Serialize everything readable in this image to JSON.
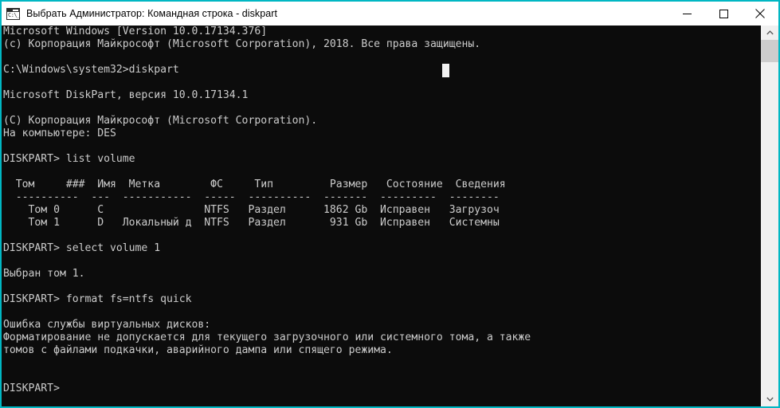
{
  "window": {
    "title": "Выбрать Администратор: Командная строка - diskpart",
    "icon": "console-icon",
    "icon_glyph": "C:\\_",
    "accent_color": "#00b7c3",
    "titlebar_bg": "#ffffff",
    "console_bg": "#0c0c0c",
    "console_fg": "#cccccc",
    "controls": {
      "minimize_label": "Свернуть",
      "maximize_label": "Развернуть",
      "close_label": "Закрыть"
    }
  },
  "scrollbar": {
    "up_arrow": "▲",
    "down_arrow": "▼",
    "thumb_position_percent": 0,
    "track_color": "#f0f0f0",
    "thumb_color": "#cdcdcd"
  },
  "console": {
    "cursor_visible": true,
    "lines": [
      "Microsoft Windows [Version 10.0.17134.376]",
      "(c) Корпорация Майкрософт (Microsoft Corporation), 2018. Все права защищены.",
      "",
      "C:\\Windows\\system32>diskpart",
      "",
      "Microsoft DiskPart, версия 10.0.17134.1",
      "",
      "(C) Корпорация Майкрософт (Microsoft Corporation).",
      "На компьютере: DES",
      "",
      "DISKPART> list volume",
      "",
      "  Том     ###  Имя  Метка        ФС     Тип         Размер   Состояние  Сведения",
      "  ----------  ---  ---  -----------  -----  ----------  -------  ---------  --------",
      "    Том 0     C                     NTFS   Раздел      1862 Gb  Исправен   Загрузоч",
      "    Том 1     D    Локальный д  NTFS   Раздел       931 Gb  Исправен   Системны",
      "",
      "DISKPART> select volume 1",
      "",
      "Выбран том 1.",
      "",
      "DISKPART> format fs=ntfs quick",
      "",
      "Ошибка службы виртуальных дисков:",
      "Форматирование не допускается для текущего загрузочного или системного тома, а также",
      "томов с файлами подкачки, аварийного дампа или спящего режима.",
      "",
      "",
      "DISKPART>"
    ],
    "rendered_text": "Microsoft Windows [Version 10.0.17134.376]\n(c) Корпорация Майкрософт (Microsoft Corporation), 2018. Все права защищены.\n\nC:\\Windows\\system32>diskpart\n\nMicrosoft DiskPart, версия 10.0.17134.1\n\n(C) Корпорация Майкрософт (Microsoft Corporation).\nНа компьютере: DES\n\nDISKPART> list volume\n\n  Том     ###  Имя  Метка        ФС     Тип         Размер   Состояние  Сведения\n  ----------  ---  -----------  -----  ----------  -------  ---------  --------\n    Том 0      C                NTFS   Раздел      1862 Gb  Исправен   Загрузоч\n    Том 1      D   Локальный д  NTFS   Раздел       931 Gb  Исправен   Системны\n\nDISKPART> select volume 1\n\nВыбран том 1.\n\nDISKPART> format fs=ntfs quick\n\nОшибка службы виртуальных дисков:\nФорматирование не допускается для текущего загрузочного или системного тома, а также\nтомов с файлами подкачки, аварийного дампа или спящего режима.\n\n\nDISKPART>",
    "volume_table": {
      "headers": [
        "Том",
        "###",
        "Имя",
        "Метка",
        "ФС",
        "Тип",
        "Размер",
        "Состояние",
        "Сведения"
      ],
      "rows": [
        [
          "Том 0",
          "",
          "C",
          "",
          "NTFS",
          "Раздел",
          "1862 Gb",
          "Исправен",
          "Загрузоч"
        ],
        [
          "Том 1",
          "",
          "D",
          "Локальный д",
          "NTFS",
          "Раздел",
          "931 Gb",
          "Исправен",
          "Системны"
        ]
      ]
    },
    "commands": [
      "diskpart",
      "list volume",
      "select volume 1",
      "format fs=ntfs quick"
    ],
    "messages": [
      "Выбран том 1.",
      "Ошибка службы виртуальных дисков:",
      "Форматирование не допускается для текущего загрузочного или системного тома, а также томов с файлами подкачки, аварийного дампа или спящего режима."
    ],
    "prompt": "DISKPART>"
  }
}
